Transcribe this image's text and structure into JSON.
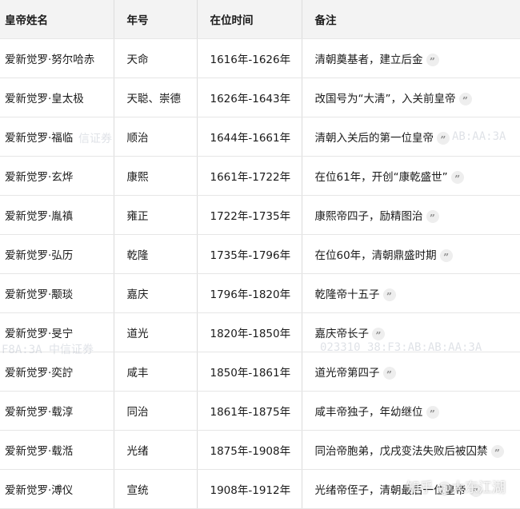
{
  "table": {
    "headers": [
      "皇帝姓名",
      "年号",
      "在位时间",
      "备注"
    ],
    "rows": [
      {
        "name": "爱新觉罗·努尔哈赤",
        "era": "天命",
        "reign": "1616年-1626年",
        "note": "清朝奠基者，建立后金"
      },
      {
        "name": "爱新觉罗·皇太极",
        "era": "天聪、崇德",
        "reign": "1626年-1643年",
        "note": "改国号为“大清”，入关前皇帝"
      },
      {
        "name": "爱新觉罗·福临",
        "era": "顺治",
        "reign": "1644年-1661年",
        "note": "清朝入关后的第一位皇帝"
      },
      {
        "name": "爱新觉罗·玄烨",
        "era": "康熙",
        "reign": "1661年-1722年",
        "note": "在位61年，开创“康乾盛世”"
      },
      {
        "name": "爱新觉罗·胤禛",
        "era": "雍正",
        "reign": "1722年-1735年",
        "note": "康熙帝四子，励精图治"
      },
      {
        "name": "爱新觉罗·弘历",
        "era": "乾隆",
        "reign": "1735年-1796年",
        "note": "在位60年，清朝鼎盛时期"
      },
      {
        "name": "爱新觉罗·颙琰",
        "era": "嘉庆",
        "reign": "1796年-1820年",
        "note": "乾隆帝十五子"
      },
      {
        "name": "爱新觉罗·旻宁",
        "era": "道光",
        "reign": "1820年-1850年",
        "note": "嘉庆帝长子"
      },
      {
        "name": "爱新觉罗·奕詝",
        "era": "咸丰",
        "reign": "1850年-1861年",
        "note": "道光帝第四子"
      },
      {
        "name": "爱新觉罗·载淳",
        "era": "同治",
        "reign": "1861年-1875年",
        "note": "咸丰帝独子，年幼继位"
      },
      {
        "name": "爱新觉罗·载湉",
        "era": "光绪",
        "reign": "1875年-1908年",
        "note": "同治帝胞弟，戊戌变法失败后被囚禁"
      },
      {
        "name": "爱新觉罗·溥仪",
        "era": "宣统",
        "reign": "1908年-1912年",
        "note": "光绪帝侄子，清朝最后一位皇帝"
      }
    ],
    "quote_glyph": "”"
  },
  "watermarks": {
    "text_1": "信证券",
    "text_2": "AB:AA:3A",
    "text_3": "F8A:3A  中信证券",
    "text_4": "023310  38:F3:AB:AB:AA:3A",
    "site": "知乎 @大东江湖"
  }
}
